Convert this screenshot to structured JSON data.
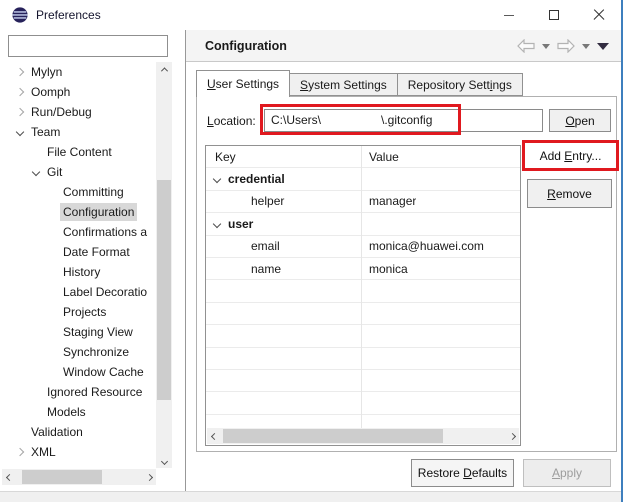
{
  "window": {
    "title": "Preferences"
  },
  "sidebar": {
    "filter_value": "",
    "tree": [
      {
        "label": "Mylyn",
        "level": 0,
        "state": "collapsed",
        "selected": false
      },
      {
        "label": "Oomph",
        "level": 0,
        "state": "collapsed",
        "selected": false
      },
      {
        "label": "Run/Debug",
        "level": 0,
        "state": "collapsed",
        "selected": false
      },
      {
        "label": "Team",
        "level": 0,
        "state": "expanded",
        "selected": false
      },
      {
        "label": "File Content",
        "level": 1,
        "state": "leaf",
        "selected": false
      },
      {
        "label": "Git",
        "level": 1,
        "state": "expanded",
        "selected": false
      },
      {
        "label": "Committing",
        "level": 2,
        "state": "leaf",
        "selected": false
      },
      {
        "label": "Configuration",
        "level": 2,
        "state": "leaf",
        "selected": true
      },
      {
        "label": "Confirmations a",
        "level": 2,
        "state": "leaf",
        "selected": false
      },
      {
        "label": "Date Format",
        "level": 2,
        "state": "leaf",
        "selected": false
      },
      {
        "label": "History",
        "level": 2,
        "state": "leaf",
        "selected": false
      },
      {
        "label": "Label Decoratio",
        "level": 2,
        "state": "leaf",
        "selected": false
      },
      {
        "label": "Projects",
        "level": 2,
        "state": "leaf",
        "selected": false
      },
      {
        "label": "Staging View",
        "level": 2,
        "state": "leaf",
        "selected": false
      },
      {
        "label": "Synchronize",
        "level": 2,
        "state": "leaf",
        "selected": false
      },
      {
        "label": "Window Cache",
        "level": 2,
        "state": "leaf",
        "selected": false
      },
      {
        "label": "Ignored Resource",
        "level": 1,
        "state": "leaf",
        "selected": false
      },
      {
        "label": "Models",
        "level": 1,
        "state": "leaf",
        "selected": false
      },
      {
        "label": "Validation",
        "level": 0,
        "state": "leaf",
        "selected": false
      },
      {
        "label": "XML",
        "level": 0,
        "state": "collapsed",
        "selected": false
      }
    ]
  },
  "content": {
    "page_title": "Configuration",
    "tabs": [
      {
        "label": "&User Settings",
        "active": true
      },
      {
        "label": "&System Settings",
        "active": false
      },
      {
        "label": "Repository Sett&ings",
        "active": false
      }
    ],
    "location": {
      "label": "&Location:",
      "value": "C:\\Users\\                  \\.gitconfig",
      "open_button": "&Open"
    },
    "table": {
      "columns": [
        "Key",
        "Value"
      ],
      "rows": [
        {
          "key": "credential",
          "value": "",
          "type": "group"
        },
        {
          "key": "helper",
          "value": "manager",
          "type": "entry"
        },
        {
          "key": "user",
          "value": "",
          "type": "group"
        },
        {
          "key": "email",
          "value": "monica@huawei.com",
          "type": "entry"
        },
        {
          "key": "name",
          "value": "monica",
          "type": "entry"
        }
      ]
    },
    "side_buttons": {
      "add_entry": "Add &Entry...",
      "remove": "&Remove"
    },
    "footer_buttons": {
      "restore_defaults": "Restore &Defaults",
      "apply": "&Apply",
      "apply_enabled": false
    }
  },
  "icons": {
    "app": "eclipse-logo-icon",
    "titlebar": [
      "minimize-icon",
      "maximize-icon",
      "close-icon"
    ],
    "navigation": [
      "back-arrow-icon",
      "dropdown-caret-icon",
      "forward-arrow-icon",
      "dropdown-caret-icon",
      "view-menu-icon"
    ],
    "tree": [
      "chevron-right-icon",
      "chevron-down-icon"
    ]
  },
  "colors": {
    "annotation_red": "#e0191f",
    "window_border_blue": "#3e7fbe",
    "selection_gray": "#d8d8d8",
    "header_bg": "#f4f4f4"
  }
}
